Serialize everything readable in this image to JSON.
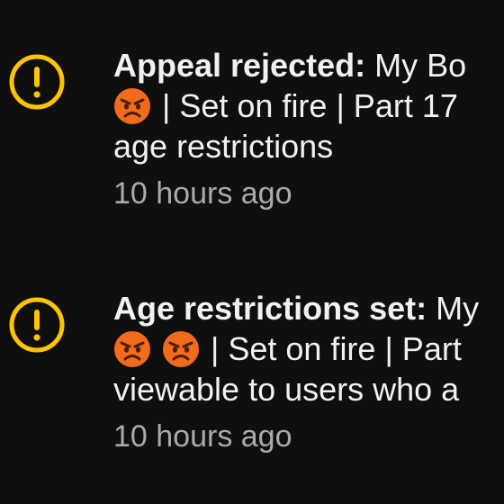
{
  "notifications": [
    {
      "icon": "alert-circle-icon",
      "headline": "Appeal rejected:",
      "line1_rest": "My Bo",
      "emoji_count": 1,
      "line2_rest": "| Set on fire | Part 17",
      "line3": "age restrictions",
      "time": "10 hours ago"
    },
    {
      "icon": "alert-circle-icon",
      "headline": "Age restrictions set:",
      "line1_rest": "My",
      "emoji_count": 2,
      "line2_rest": "| Set on fire | Part",
      "line3": "viewable to users who a",
      "time": "10 hours ago"
    }
  ],
  "colors": {
    "background": "#0f0f0f",
    "icon": "#ffc400",
    "text": "#f1f1f1",
    "secondary_text": "#aaaaaa",
    "emoji_face": "#f26a1b"
  }
}
